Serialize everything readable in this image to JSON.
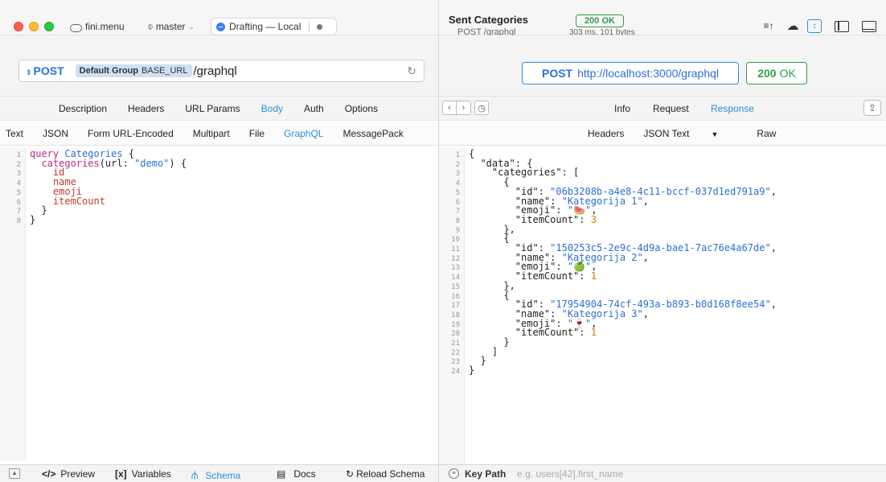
{
  "titlebar": {
    "workspace": "fini.menu",
    "branch": "master",
    "drafting": "Drafting — Local"
  },
  "sent": {
    "title": "Sent Categories",
    "subtitle": "POST /graphql",
    "status": "200 OK",
    "timing": "303 ms, 101 bytes"
  },
  "request": {
    "method": "POST",
    "group_bold": "Default Group",
    "group_var": "BASE_URL",
    "path": "/graphql",
    "tabs": [
      "Description",
      "Headers",
      "URL Params",
      "Body",
      "Auth",
      "Options"
    ],
    "body_types": [
      "Text",
      "JSON",
      "Form URL-Encoded",
      "Multipart",
      "File",
      "GraphQL",
      "MessagePack"
    ],
    "code": {
      "l1a": "query",
      "l1b": "Categories",
      "l1c": " {",
      "l2a": "  categories",
      "l2b": "(url: ",
      "l2c": "\"demo\"",
      "l2d": ") {",
      "l3": "    id",
      "l4": "    name",
      "l5": "    emoji",
      "l6": "    itemCount",
      "l7": "  }",
      "l8": "}"
    },
    "bottom": {
      "preview": "Preview",
      "variables": "Variables",
      "schema": "Schema",
      "docs": "Docs",
      "reload": "Reload Schema"
    }
  },
  "response": {
    "method": "POST",
    "url": "http://localhost:3000/graphql",
    "status_code": "200",
    "status_text": "OK",
    "tabs": [
      "Info",
      "Request",
      "Response"
    ],
    "sub_tabs": [
      "Headers",
      "JSON Text",
      "Raw"
    ],
    "keypath_label": "Key Path",
    "keypath_placeholder": "e.g. users[42].first_name",
    "json": {
      "items": [
        {
          "id": "06b3208b-a4e8-4c11-bccf-037d1ed791a9",
          "name": "Kategorija 1",
          "emoji": "🍉",
          "itemCount": "3"
        },
        {
          "id": "150253c5-2e9c-4d9a-bae1-7ac76e4a67de",
          "name": "Kategorija 2",
          "emoji": "🍏",
          "itemCount": "1"
        },
        {
          "id": "17954904-74cf-493a-b893-b0d168f8ee54",
          "name": "Kategorija 3",
          "emoji": "🍷",
          "itemCount": "1"
        }
      ]
    }
  }
}
